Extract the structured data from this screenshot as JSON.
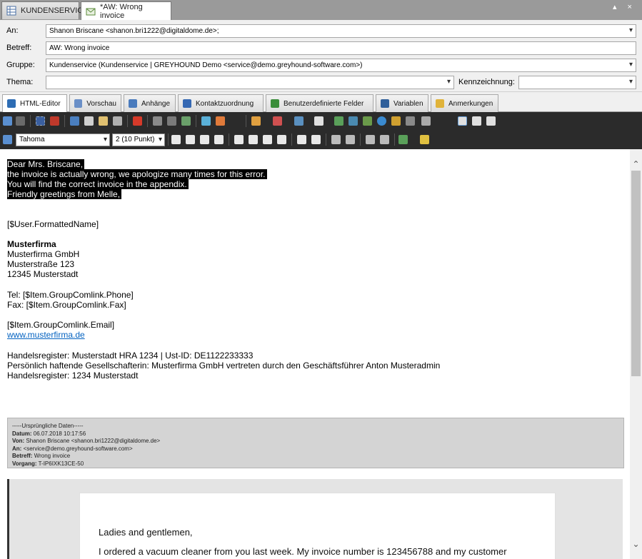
{
  "tabs": {
    "inactive": "KUNDENSERVICE",
    "active": "*AW: Wrong invoice"
  },
  "window_controls": "▴ ×",
  "fields": {
    "an_label": "An:",
    "an_value": "Shanon Briscane <shanon.bri1222@digitaldome.de>;",
    "betreff_label": "Betreff:",
    "betreff_value": "AW: Wrong invoice",
    "gruppe_label": "Gruppe:",
    "gruppe_value": "Kundenservice (Kundenservice | GREYHOUND Demo <service@demo.greyhound-software.com>)",
    "thema_label": "Thema:",
    "thema_value": "",
    "kennzeichnung_label": "Kennzeichnung:",
    "kennzeichnung_value": ""
  },
  "feature_tabs": [
    {
      "label": "HTML-Editor",
      "color": "#2e6db4"
    },
    {
      "label": "Vorschau",
      "color": "#6a8fc7"
    },
    {
      "label": "Anhänge",
      "color": "#4a7bbd"
    },
    {
      "label": "Kontaktzuordnung",
      "color": "#3568b3"
    },
    {
      "label": "Benutzerdefinierte Felder",
      "color": "#3a8d3a"
    },
    {
      "label": "Variablen",
      "color": "#2f5f9a"
    },
    {
      "label": "Anmerkungen",
      "color": "#e0b33a"
    }
  ],
  "format": {
    "font": "Tahoma",
    "size": "2 (10 Punkt)"
  },
  "body": {
    "selected_lines": [
      "Dear Mrs. Briscane,",
      "the invoice is actually wrong, we apologize many times for this error.",
      "You will find the correct invoice in the appendix.",
      "Friendly greetings from Melle,"
    ],
    "user_name": "[$User.FormattedName]",
    "company_bold": "Musterfirma",
    "company": "Musterfirma GmbH",
    "street": "Musterstraße 123",
    "city": "12345 Musterstadt",
    "tel": "Tel: [$Item.GroupComlink.Phone]",
    "fax": "Fax: [$Item.GroupComlink.Fax]",
    "email": "[$Item.GroupComlink.Email]",
    "website": "www.musterfirma.de",
    "register1": "Handelsregister: Musterstadt HRA 1234 | Ust-ID: DE1122233333",
    "liable": "Persönlich haftende Gesellschafterin: Musterfirma GmbH vertreten durch den Geschäftsführer Anton Musteradmin",
    "register2": "Handelsregister: 1234 Musterstadt"
  },
  "quote": {
    "header": "-----Ursprüngliche Daten-----",
    "datum_label": "Datum:",
    "datum_value": "06.07.2018 10:17:56",
    "von_label": "Von:",
    "von_value": "Shanon Briscane <shanon.bri1222@digitaldome.de>",
    "an_label": "An:",
    "an_value": "<service@demo.greyhound-software.com>",
    "betreff_label": "Betreff:",
    "betreff_value": "Wrong invoice",
    "vorgang_label": "Vorgang:",
    "vorgang_value": "T-IP6IXK13CE-50"
  },
  "original": {
    "greeting": "Ladies and gentlemen,",
    "line1": "I ordered a vacuum cleaner from you last week. My invoice number is 123456788 and my customer"
  }
}
